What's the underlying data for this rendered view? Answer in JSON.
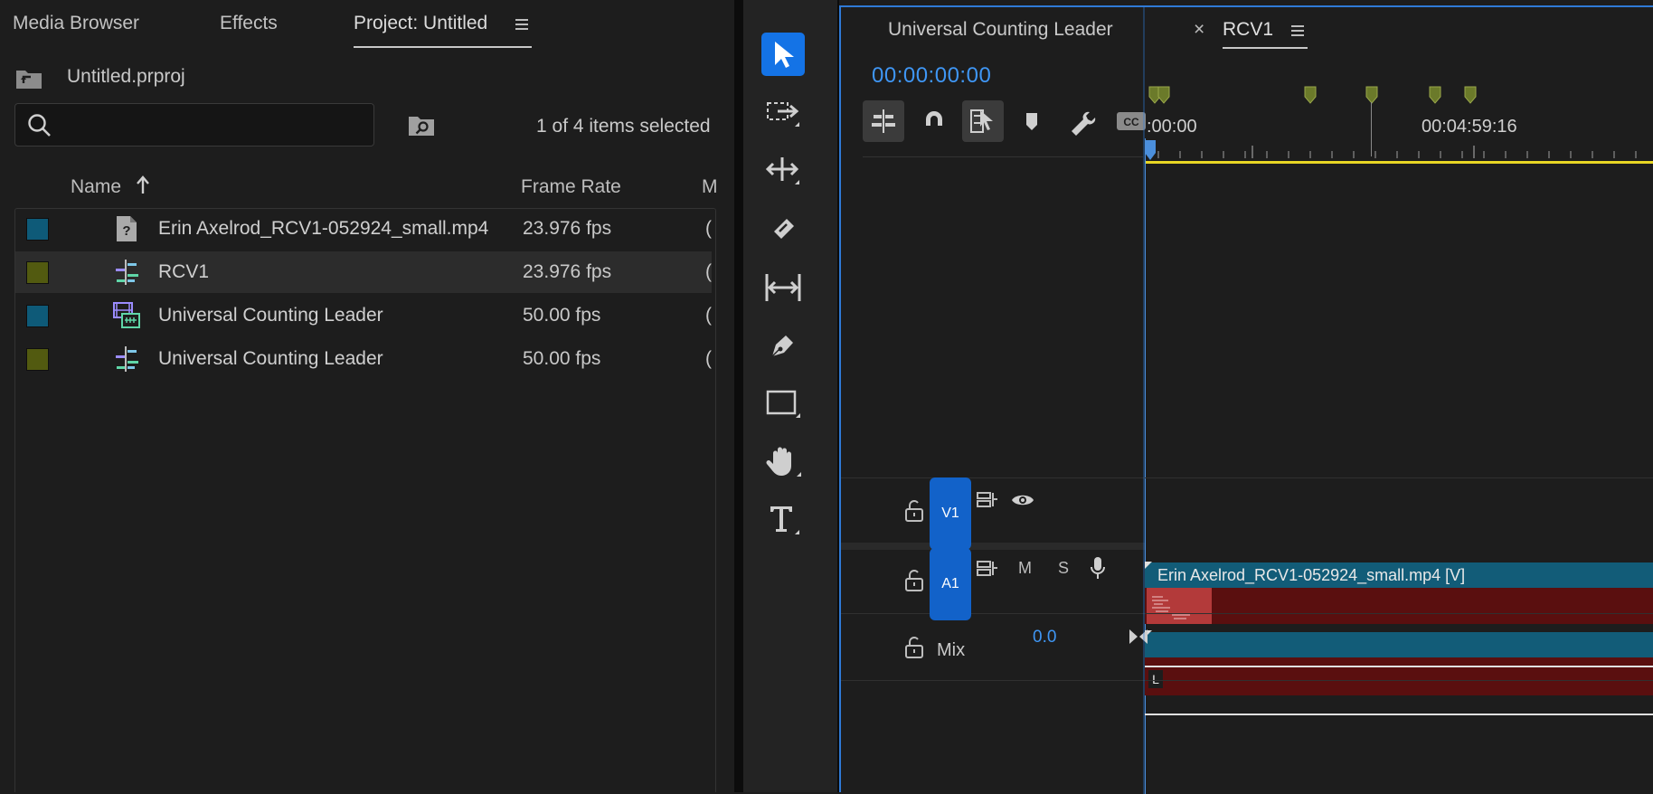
{
  "project_panel": {
    "tabs": [
      "Media Browser",
      "Effects",
      "Project: Untitled"
    ],
    "project_file": "Untitled.prproj",
    "search": {
      "value": "",
      "placeholder": ""
    },
    "selection_status": "1 of 4 items selected",
    "columns": {
      "name": "Name",
      "frame_rate": "Frame Rate",
      "media_start_cut": "M"
    },
    "items": [
      {
        "name": "Erin Axelrod_RCV1-052924_small.mp4",
        "frame_rate": "23.976 fps",
        "label_color": "#0e5a78",
        "icon": "missing-media-icon",
        "selected": false
      },
      {
        "name": "RCV1",
        "frame_rate": "23.976 fps",
        "label_color": "#525a10",
        "icon": "sequence-icon",
        "selected": true
      },
      {
        "name": "Universal Counting Leader",
        "frame_rate": "50.00 fps",
        "label_color": "#0e5a78",
        "icon": "synthetic-media-icon",
        "selected": false
      },
      {
        "name": "Universal Counting Leader",
        "frame_rate": "50.00 fps",
        "label_color": "#525a10",
        "icon": "sequence-icon",
        "selected": false
      }
    ],
    "cut_glyph": "("
  },
  "tools": [
    "selection-tool-icon",
    "track-select-tool-icon",
    "ripple-edit-tool-icon",
    "razor-tool-icon",
    "slip-tool-icon",
    "pen-tool-icon",
    "rectangle-tool-icon",
    "hand-tool-icon",
    "type-tool-icon"
  ],
  "timeline": {
    "tabs": [
      "Universal Counting Leader",
      "RCV1"
    ],
    "close_glyph": "×",
    "timecode": "00:00:00:00",
    "ruler_labels": [
      ":00:00",
      "00:04:59:16"
    ],
    "tracks": {
      "v1": {
        "label": "V1",
        "clip_name": "Erin Axelrod_RCV1-052924_small.mp4 [V]"
      },
      "a1": {
        "label": "A1",
        "mute": "M",
        "solo": "S",
        "channel_badge": "L"
      },
      "mix": {
        "label": "Mix",
        "value": "0.0"
      }
    },
    "colors": {
      "accent": "#1473e6",
      "timecode": "#3f96f4",
      "clip_video_body": "#5a0f0f",
      "clip_title_bar": "#125c78",
      "marker": "#6b7a2a",
      "work_area": "#e8d624"
    }
  }
}
